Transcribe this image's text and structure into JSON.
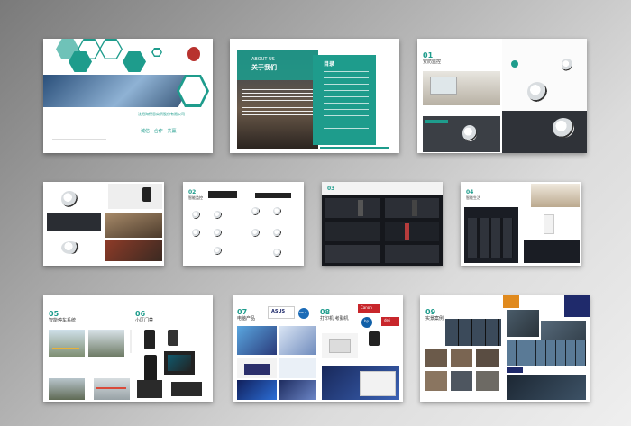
{
  "colors": {
    "accent": "#1e9c8c",
    "dark": "#1a1d24",
    "orange": "#e08a1e",
    "red": "#c8262b",
    "navy": "#1f2a6b"
  },
  "cover": {
    "company": "沈阳海德思商贸股份有限公司",
    "slogan": "诚信 · 合作 · 共赢"
  },
  "about": {
    "heading_en": "ABOUT US",
    "heading_cn": "关于我们",
    "toc_title": "目录"
  },
  "sections": [
    {
      "num": "01",
      "title": "安防监控"
    },
    {
      "num": "02",
      "title": "智能监控"
    },
    {
      "num": "03",
      "title": ""
    },
    {
      "num": "04",
      "title": "智能生活"
    },
    {
      "num": "05",
      "title": "智能停车系统"
    },
    {
      "num": "06",
      "title": "小区门禁"
    },
    {
      "num": "07",
      "title": "电脑产品"
    },
    {
      "num": "08",
      "title": "打印机 考勤机"
    },
    {
      "num": "09",
      "title": "实景案例"
    }
  ],
  "brands": {
    "asus": "ASUS",
    "dell": "DELL",
    "hp": "hp",
    "canon": "Canon",
    "deli": "deli"
  }
}
